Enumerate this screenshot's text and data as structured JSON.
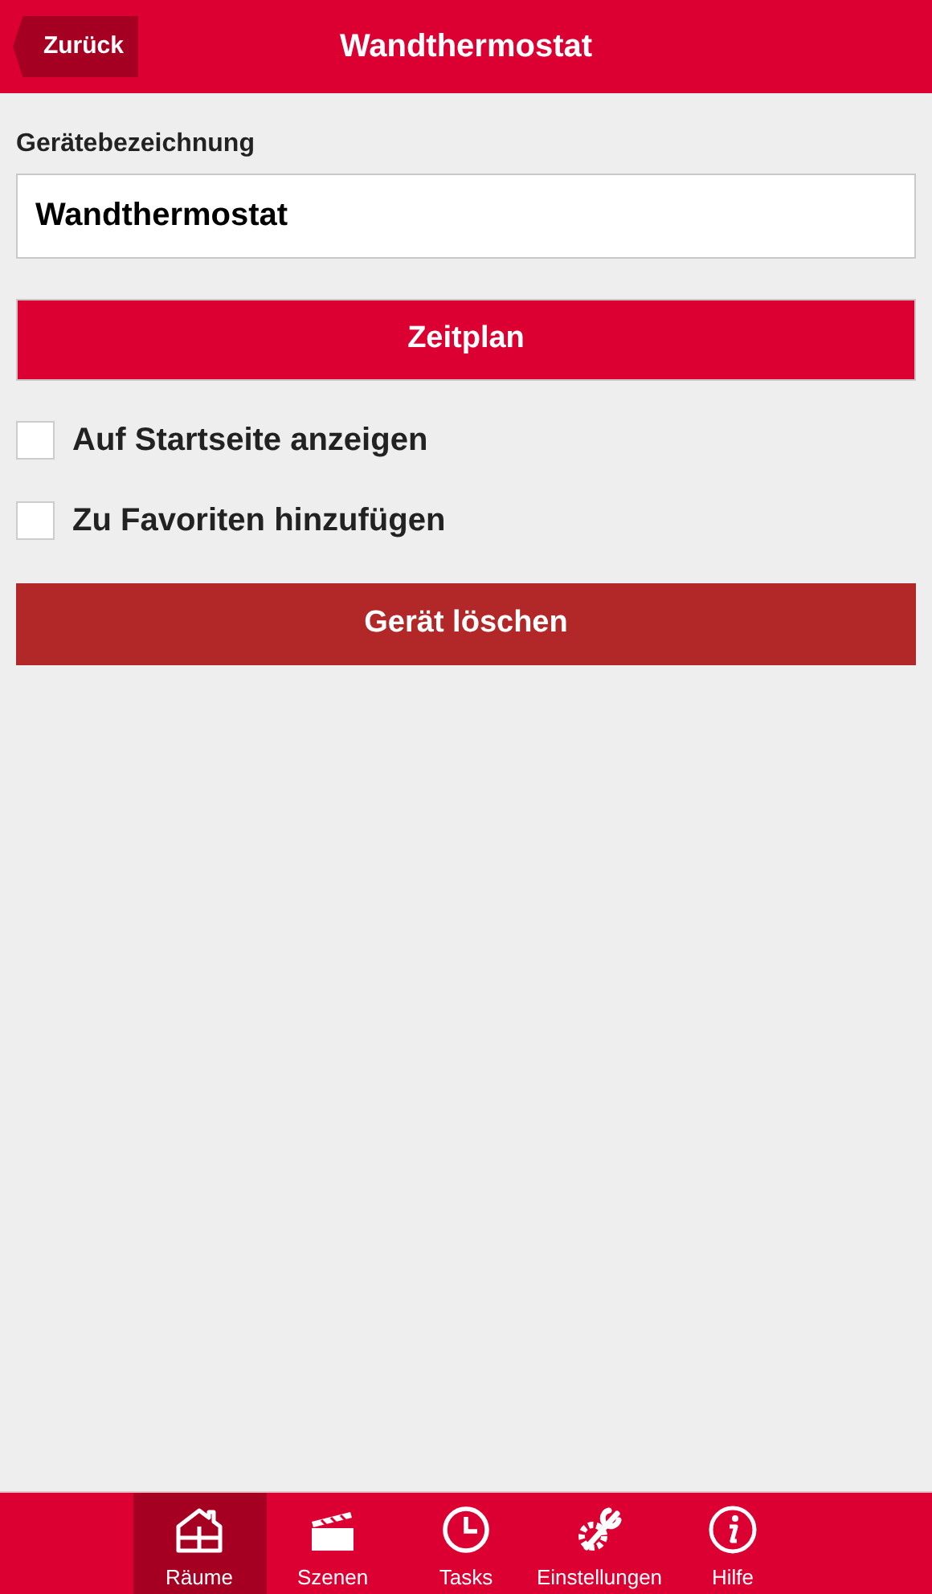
{
  "header": {
    "back": "Zurück",
    "title": "Wandthermostat"
  },
  "name_field": {
    "label": "Gerätebezeichnung",
    "value": "Wandthermostat"
  },
  "schedule_button": "Zeitplan",
  "options": [
    {
      "label": "Auf Startseite anzeigen",
      "checked": false
    },
    {
      "label": "Zu Favoriten hinzufügen",
      "checked": false
    }
  ],
  "delete_button": "Gerät löschen",
  "tabs": [
    {
      "label": "Räume",
      "kind": "house",
      "selected": true
    },
    {
      "label": "Szenen",
      "kind": "clapper",
      "selected": false
    },
    {
      "label": "Tasks",
      "kind": "clock",
      "selected": false
    },
    {
      "label": "Einstellungen",
      "kind": "tools",
      "selected": false
    },
    {
      "label": "Hilfe",
      "kind": "info",
      "selected": false
    }
  ]
}
